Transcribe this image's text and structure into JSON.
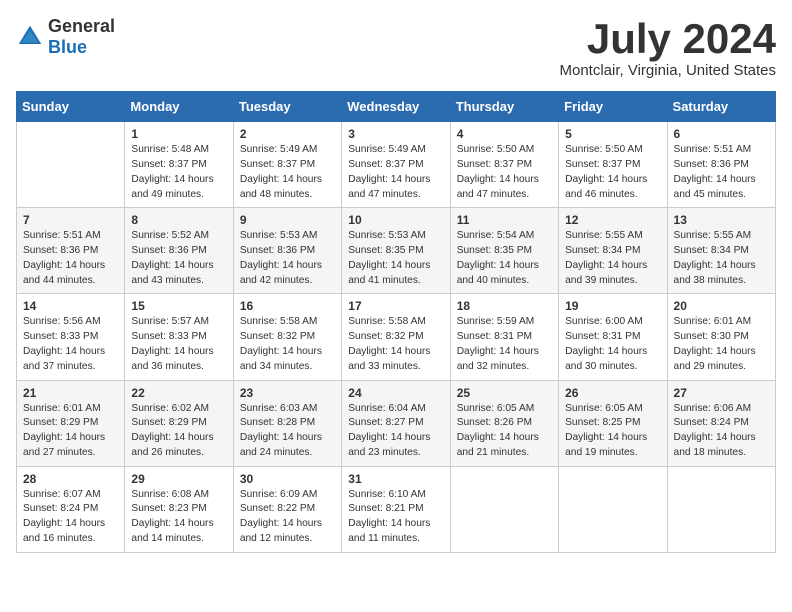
{
  "logo": {
    "general": "General",
    "blue": "Blue"
  },
  "title": "July 2024",
  "location": "Montclair, Virginia, United States",
  "days_of_week": [
    "Sunday",
    "Monday",
    "Tuesday",
    "Wednesday",
    "Thursday",
    "Friday",
    "Saturday"
  ],
  "weeks": [
    [
      {
        "day": "",
        "info": ""
      },
      {
        "day": "1",
        "info": "Sunrise: 5:48 AM\nSunset: 8:37 PM\nDaylight: 14 hours\nand 49 minutes."
      },
      {
        "day": "2",
        "info": "Sunrise: 5:49 AM\nSunset: 8:37 PM\nDaylight: 14 hours\nand 48 minutes."
      },
      {
        "day": "3",
        "info": "Sunrise: 5:49 AM\nSunset: 8:37 PM\nDaylight: 14 hours\nand 47 minutes."
      },
      {
        "day": "4",
        "info": "Sunrise: 5:50 AM\nSunset: 8:37 PM\nDaylight: 14 hours\nand 47 minutes."
      },
      {
        "day": "5",
        "info": "Sunrise: 5:50 AM\nSunset: 8:37 PM\nDaylight: 14 hours\nand 46 minutes."
      },
      {
        "day": "6",
        "info": "Sunrise: 5:51 AM\nSunset: 8:36 PM\nDaylight: 14 hours\nand 45 minutes."
      }
    ],
    [
      {
        "day": "7",
        "info": "Sunrise: 5:51 AM\nSunset: 8:36 PM\nDaylight: 14 hours\nand 44 minutes."
      },
      {
        "day": "8",
        "info": "Sunrise: 5:52 AM\nSunset: 8:36 PM\nDaylight: 14 hours\nand 43 minutes."
      },
      {
        "day": "9",
        "info": "Sunrise: 5:53 AM\nSunset: 8:36 PM\nDaylight: 14 hours\nand 42 minutes."
      },
      {
        "day": "10",
        "info": "Sunrise: 5:53 AM\nSunset: 8:35 PM\nDaylight: 14 hours\nand 41 minutes."
      },
      {
        "day": "11",
        "info": "Sunrise: 5:54 AM\nSunset: 8:35 PM\nDaylight: 14 hours\nand 40 minutes."
      },
      {
        "day": "12",
        "info": "Sunrise: 5:55 AM\nSunset: 8:34 PM\nDaylight: 14 hours\nand 39 minutes."
      },
      {
        "day": "13",
        "info": "Sunrise: 5:55 AM\nSunset: 8:34 PM\nDaylight: 14 hours\nand 38 minutes."
      }
    ],
    [
      {
        "day": "14",
        "info": "Sunrise: 5:56 AM\nSunset: 8:33 PM\nDaylight: 14 hours\nand 37 minutes."
      },
      {
        "day": "15",
        "info": "Sunrise: 5:57 AM\nSunset: 8:33 PM\nDaylight: 14 hours\nand 36 minutes."
      },
      {
        "day": "16",
        "info": "Sunrise: 5:58 AM\nSunset: 8:32 PM\nDaylight: 14 hours\nand 34 minutes."
      },
      {
        "day": "17",
        "info": "Sunrise: 5:58 AM\nSunset: 8:32 PM\nDaylight: 14 hours\nand 33 minutes."
      },
      {
        "day": "18",
        "info": "Sunrise: 5:59 AM\nSunset: 8:31 PM\nDaylight: 14 hours\nand 32 minutes."
      },
      {
        "day": "19",
        "info": "Sunrise: 6:00 AM\nSunset: 8:31 PM\nDaylight: 14 hours\nand 30 minutes."
      },
      {
        "day": "20",
        "info": "Sunrise: 6:01 AM\nSunset: 8:30 PM\nDaylight: 14 hours\nand 29 minutes."
      }
    ],
    [
      {
        "day": "21",
        "info": "Sunrise: 6:01 AM\nSunset: 8:29 PM\nDaylight: 14 hours\nand 27 minutes."
      },
      {
        "day": "22",
        "info": "Sunrise: 6:02 AM\nSunset: 8:29 PM\nDaylight: 14 hours\nand 26 minutes."
      },
      {
        "day": "23",
        "info": "Sunrise: 6:03 AM\nSunset: 8:28 PM\nDaylight: 14 hours\nand 24 minutes."
      },
      {
        "day": "24",
        "info": "Sunrise: 6:04 AM\nSunset: 8:27 PM\nDaylight: 14 hours\nand 23 minutes."
      },
      {
        "day": "25",
        "info": "Sunrise: 6:05 AM\nSunset: 8:26 PM\nDaylight: 14 hours\nand 21 minutes."
      },
      {
        "day": "26",
        "info": "Sunrise: 6:05 AM\nSunset: 8:25 PM\nDaylight: 14 hours\nand 19 minutes."
      },
      {
        "day": "27",
        "info": "Sunrise: 6:06 AM\nSunset: 8:24 PM\nDaylight: 14 hours\nand 18 minutes."
      }
    ],
    [
      {
        "day": "28",
        "info": "Sunrise: 6:07 AM\nSunset: 8:24 PM\nDaylight: 14 hours\nand 16 minutes."
      },
      {
        "day": "29",
        "info": "Sunrise: 6:08 AM\nSunset: 8:23 PM\nDaylight: 14 hours\nand 14 minutes."
      },
      {
        "day": "30",
        "info": "Sunrise: 6:09 AM\nSunset: 8:22 PM\nDaylight: 14 hours\nand 12 minutes."
      },
      {
        "day": "31",
        "info": "Sunrise: 6:10 AM\nSunset: 8:21 PM\nDaylight: 14 hours\nand 11 minutes."
      },
      {
        "day": "",
        "info": ""
      },
      {
        "day": "",
        "info": ""
      },
      {
        "day": "",
        "info": ""
      }
    ]
  ]
}
